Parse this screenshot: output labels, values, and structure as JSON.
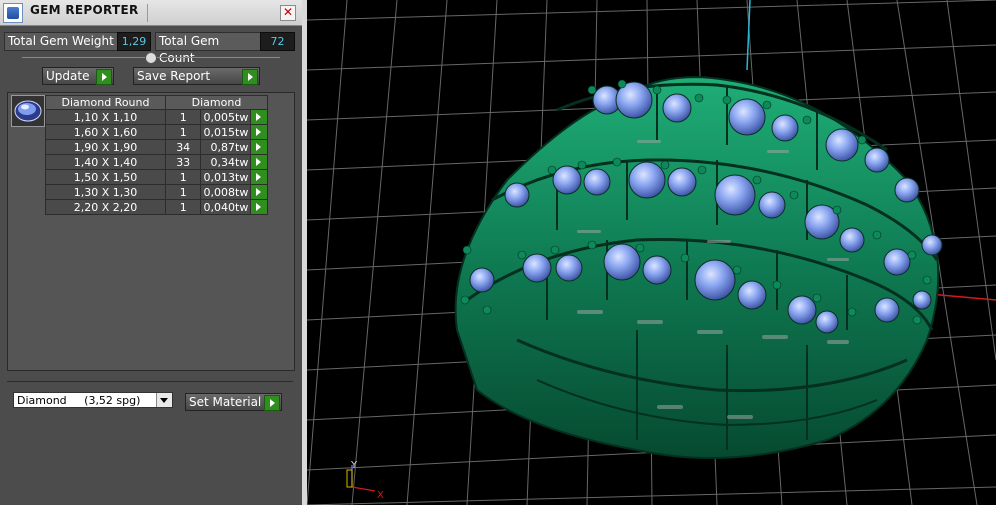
{
  "window": {
    "title": "GEM REPORTER",
    "close_label": "✕"
  },
  "stats": {
    "weight_label": "Total Gem Weight",
    "weight_value": "1,29",
    "count_label": "Total Gem Count",
    "count_value": "72"
  },
  "buttons": {
    "update": "Update",
    "save_report": "Save Report",
    "set_material": "Set Material"
  },
  "table": {
    "headers": [
      "Diamond Round",
      "Diamond"
    ],
    "rows": [
      {
        "size": "1,10 X 1,10",
        "count": "1",
        "weight": "0,005tw"
      },
      {
        "size": "1,60 X 1,60",
        "count": "1",
        "weight": "0,015tw"
      },
      {
        "size": "1,90 X 1,90",
        "count": "34",
        "weight": "0,87tw"
      },
      {
        "size": "1,40 X 1,40",
        "count": "33",
        "weight": "0,34tw"
      },
      {
        "size": "1,50 X 1,50",
        "count": "1",
        "weight": "0,013tw"
      },
      {
        "size": "1,30 X 1,30",
        "count": "1",
        "weight": "0,008tw"
      },
      {
        "size": "2,20 X 2,20",
        "count": "1",
        "weight": "0,040tw"
      }
    ]
  },
  "material": {
    "selected": "Diamond     (3,52 spg)"
  },
  "axes": {
    "x": "X",
    "y": "Y"
  },
  "colors": {
    "gem": "#7f9cf0",
    "metal": "#0f7a52",
    "grid": "#8a8a8a",
    "axis_red": "#d41a1a",
    "axis_cyan": "#2ab8d6"
  },
  "icons": {
    "thumbnail": "diamond-round-icon"
  }
}
